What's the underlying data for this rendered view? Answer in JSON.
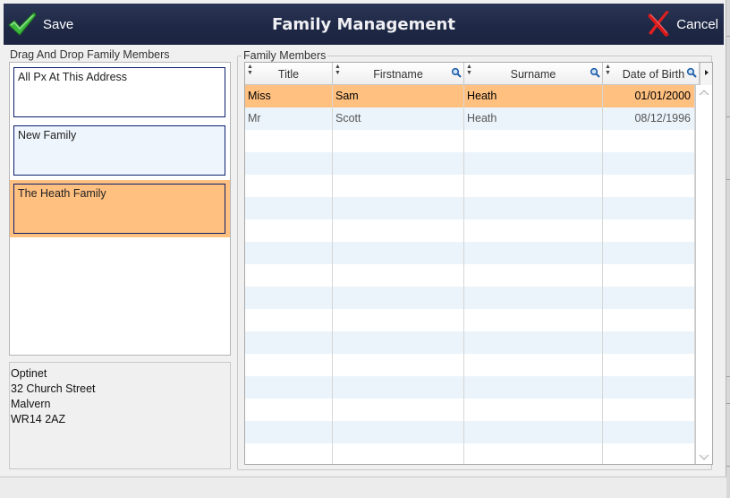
{
  "header": {
    "title": "Family Management",
    "save_label": "Save",
    "cancel_label": "Cancel"
  },
  "left": {
    "section_label": "Drag And Drop Family Members",
    "families": [
      {
        "name": "All Px At This Address"
      },
      {
        "name": "New Family"
      },
      {
        "name": "The Heath Family"
      }
    ],
    "address": {
      "line1": "Optinet",
      "line2": "32 Church Street",
      "line3": "Malvern",
      "line4": "WR14 2AZ"
    }
  },
  "members": {
    "section_label": "Family Members",
    "columns": {
      "title": "Title",
      "firstname": "Firstname",
      "surname": "Surname",
      "dob": "Date of Birth"
    },
    "rows": [
      {
        "title": "Miss",
        "firstname": "Sam",
        "surname": "Heath",
        "dob": "01/01/2000"
      },
      {
        "title": "Mr",
        "firstname": "Scott",
        "surname": "Heath",
        "dob": "08/12/1996"
      }
    ]
  },
  "colors": {
    "header_bg": "#1e2845",
    "selection": "#ffc080",
    "alt_row": "#ebf4fb",
    "card_border": "#0b1e6d",
    "selected_card_bg": "#ffc080",
    "new_family_bg": "#eef5fc"
  }
}
